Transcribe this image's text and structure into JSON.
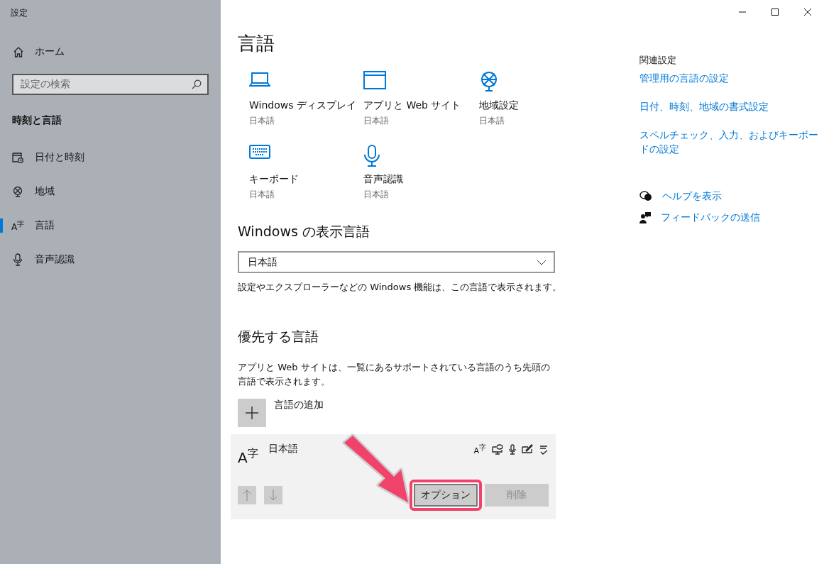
{
  "window": {
    "title": "設定"
  },
  "sidebar": {
    "home": "ホーム",
    "search": {
      "placeholder": "設定の検索"
    },
    "section": "時刻と言語",
    "items": [
      {
        "label": "日付と時刻",
        "selected": false
      },
      {
        "label": "地域",
        "selected": false
      },
      {
        "label": "言語",
        "selected": true,
        "icon_glyph": "A$^{字}$"
      },
      {
        "label": "音声認識",
        "selected": false
      }
    ]
  },
  "main": {
    "title": "言語",
    "tiles": [
      {
        "label": "Windows ディスプレイ",
        "sub": "日本語"
      },
      {
        "label": "アプリと Web サイト",
        "sub": "日本語"
      },
      {
        "label": "地域設定",
        "sub": "日本語"
      },
      {
        "label": "キーボード",
        "sub": "日本語"
      },
      {
        "label": "音声認識",
        "sub": "日本語"
      }
    ],
    "display_language": {
      "heading": "Windows の表示言語",
      "value": "日本語",
      "note": "設定やエクスプローラーなどの Windows 機能は、この言語で表示されます。"
    },
    "preferred": {
      "heading": "優先する言語",
      "description": "アプリと Web サイトは、一覧にあるサポートされている言語のうち先頭の言語で表示されます。",
      "add_label": "言語の追加",
      "languages": [
        {
          "name": "日本語",
          "icon_glyph": "A$^{字}$",
          "features": [
            {
              "kind": "glyph",
              "text": "A$^{字}$"
            },
            {
              "kind": "speech"
            },
            {
              "kind": "microphone"
            },
            {
              "kind": "handwriting"
            },
            {
              "kind": "spelling"
            }
          ],
          "buttons": [
            {
              "label": "オプション",
              "disabled": false,
              "highlighted": true
            },
            {
              "label": "削除",
              "disabled": true,
              "highlighted": false
            }
          ]
        }
      ]
    }
  },
  "related": {
    "heading": "関連設定",
    "links": [
      "管理用の言語の設定",
      "日付、時刻、地域の書式設定",
      "スペルチェック、入力、およびキーボードの設定"
    ],
    "help": [
      {
        "kind": "help",
        "label": "ヘルプを表示"
      },
      {
        "kind": "feedback",
        "label": "フィードバックの送信"
      }
    ]
  }
}
